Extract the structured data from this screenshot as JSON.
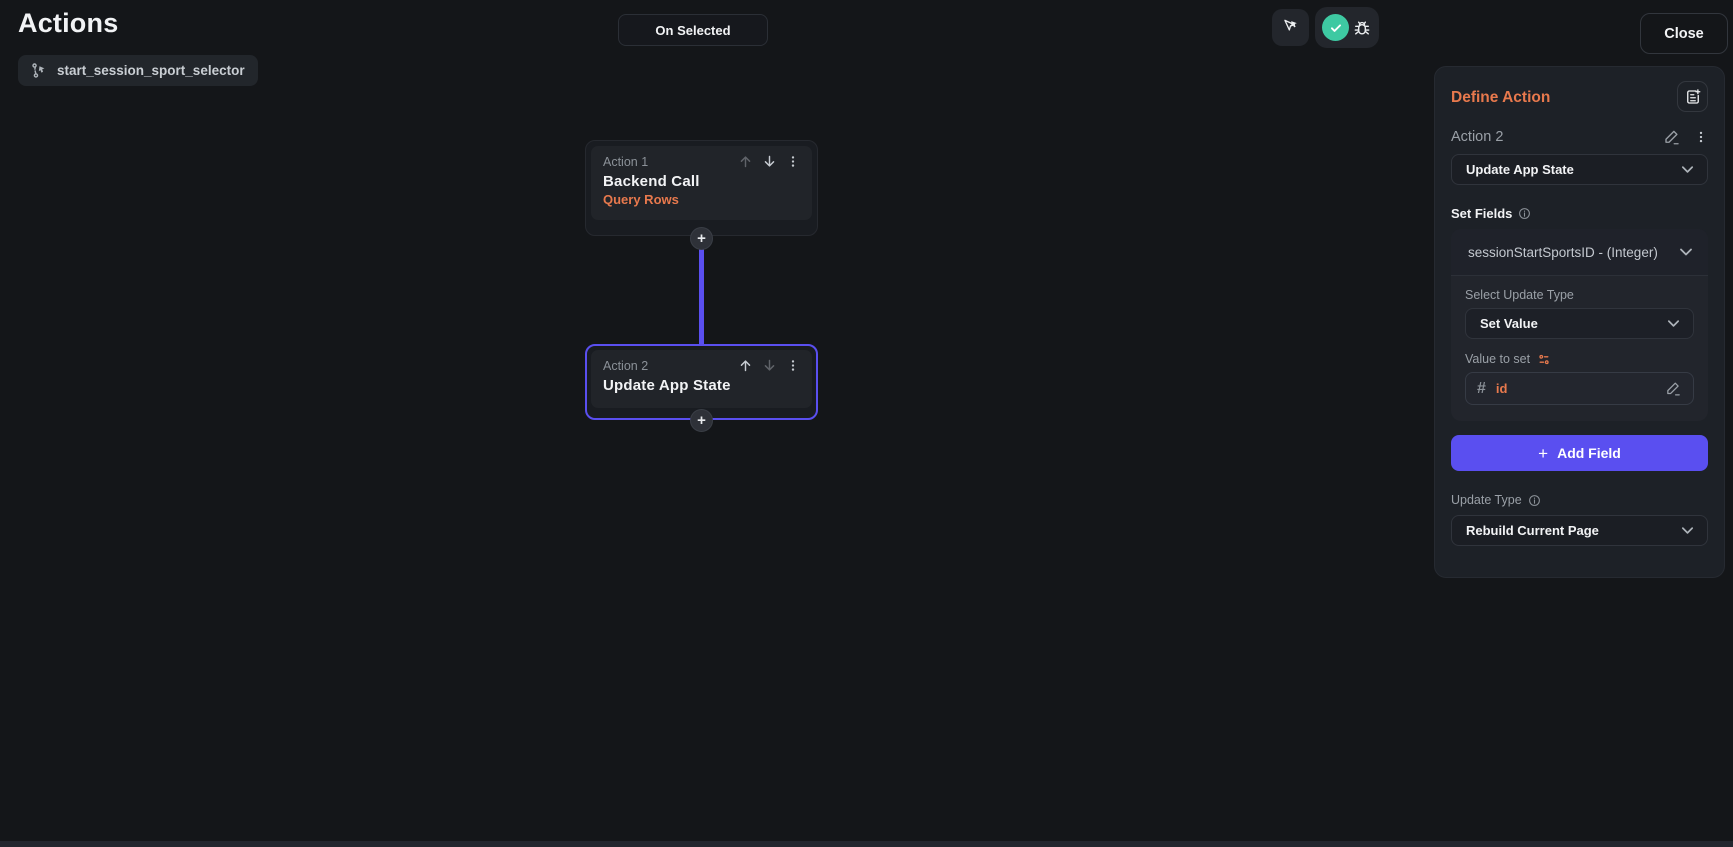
{
  "page": {
    "title": "Actions"
  },
  "header": {
    "trigger_chip": {
      "icon": "interaction-path-icon",
      "label": "start_session_sport_selector"
    },
    "on_selected_button": "On Selected",
    "close_button": "Close",
    "toolbar_icons": [
      "multi-cursor-icon",
      "check-circle-icon",
      "bug-icon"
    ]
  },
  "flow": {
    "nodes": [
      {
        "label": "Action 1",
        "title": "Backend Call",
        "subtitle": "Query Rows",
        "selected": false
      },
      {
        "label": "Action 2",
        "title": "Update App State",
        "subtitle": "",
        "selected": true
      }
    ],
    "add_node_glyph": "+"
  },
  "panel": {
    "title": "Define Action",
    "header_icon": "document-add-icon",
    "action_label": "Action 2",
    "action_type_dropdown": "Update App State",
    "set_fields": {
      "label": "Set Fields",
      "field_dropdown": "sessionStartSportsID - (Integer)",
      "select_update_type_label": "Select Update Type",
      "select_update_type_dropdown": "Set Value",
      "value_label": "Value to set",
      "value_prefix": "#",
      "value": "id"
    },
    "add_field_button": "Add Field",
    "add_field_glyph": "+",
    "update_type_label": "Update Type",
    "update_type_dropdown": "Rebuild Current Page"
  },
  "colors": {
    "orange": "#e8794d",
    "purple": "#5a4ff0",
    "teal": "#3ec9a2",
    "bg": "#141619",
    "surface": "#1d2127"
  }
}
